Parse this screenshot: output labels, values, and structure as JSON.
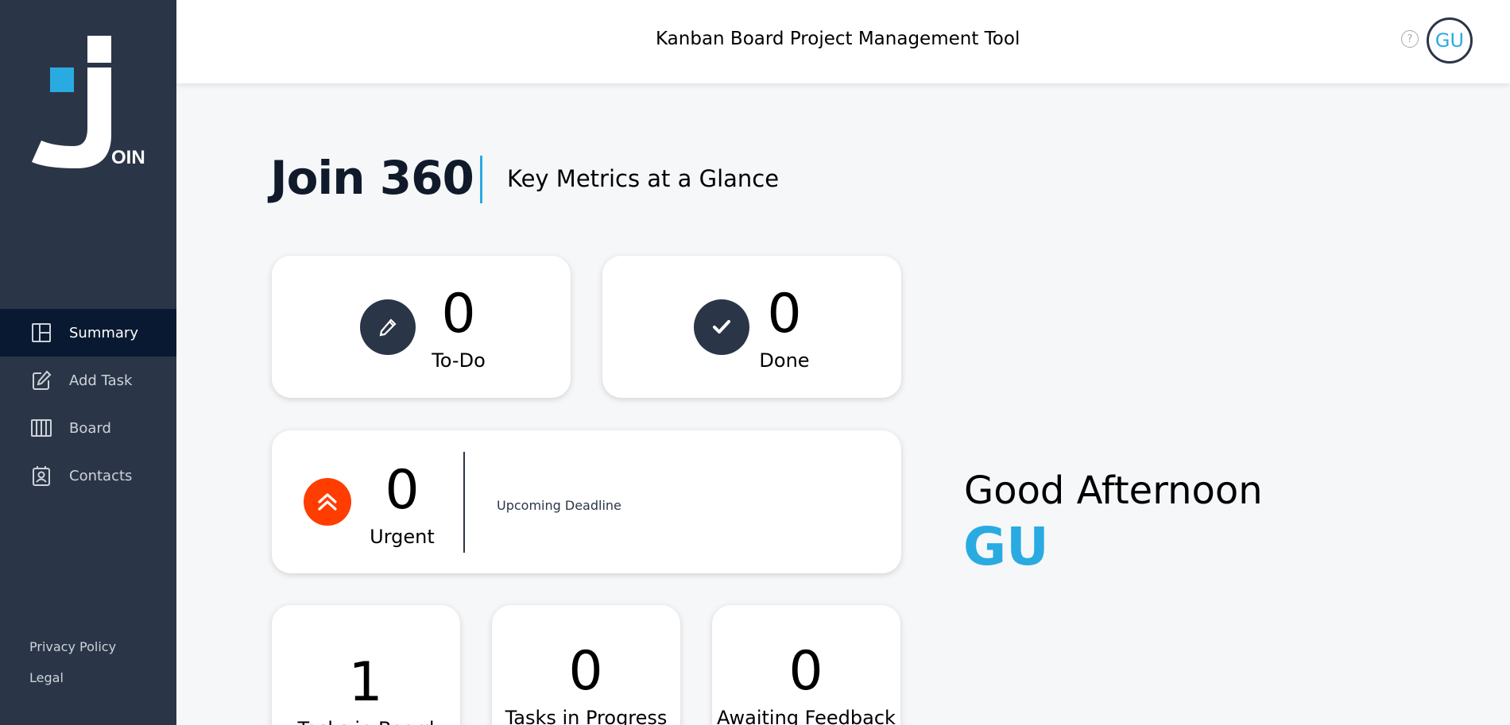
{
  "header": {
    "title": "Kanban Board Project Management Tool",
    "help_icon": "?",
    "user_initials": "GU"
  },
  "sidebar": {
    "logo_text": "OIN",
    "items": [
      {
        "label": "Summary",
        "icon": "summary-icon",
        "active": true
      },
      {
        "label": "Add Task",
        "icon": "add-task-icon",
        "active": false
      },
      {
        "label": "Board",
        "icon": "board-icon",
        "active": false
      },
      {
        "label": "Contacts",
        "icon": "contacts-icon",
        "active": false
      }
    ],
    "footer_links": [
      "Privacy Policy",
      "Legal"
    ]
  },
  "main": {
    "title": "Join 360",
    "subtitle": "Key Metrics at a Glance",
    "metrics": {
      "todo": {
        "count": "0",
        "label": "To-Do"
      },
      "done": {
        "count": "0",
        "label": "Done"
      },
      "urgent": {
        "count": "0",
        "label": "Urgent",
        "deadline_label": "Upcoming Deadline"
      },
      "in_board": {
        "count": "1",
        "label": "Tasks in Board"
      },
      "in_progress": {
        "count": "0",
        "label": "Tasks in Progress"
      },
      "awaiting": {
        "count": "0",
        "label": "Awaiting Feedback"
      }
    },
    "greeting": "Good Afternoon",
    "greeting_name": "GU"
  },
  "colors": {
    "sidebar_bg": "#2a3647",
    "active_nav_bg": "#091931",
    "accent": "#29abe2",
    "urgent": "#ff3d00"
  }
}
